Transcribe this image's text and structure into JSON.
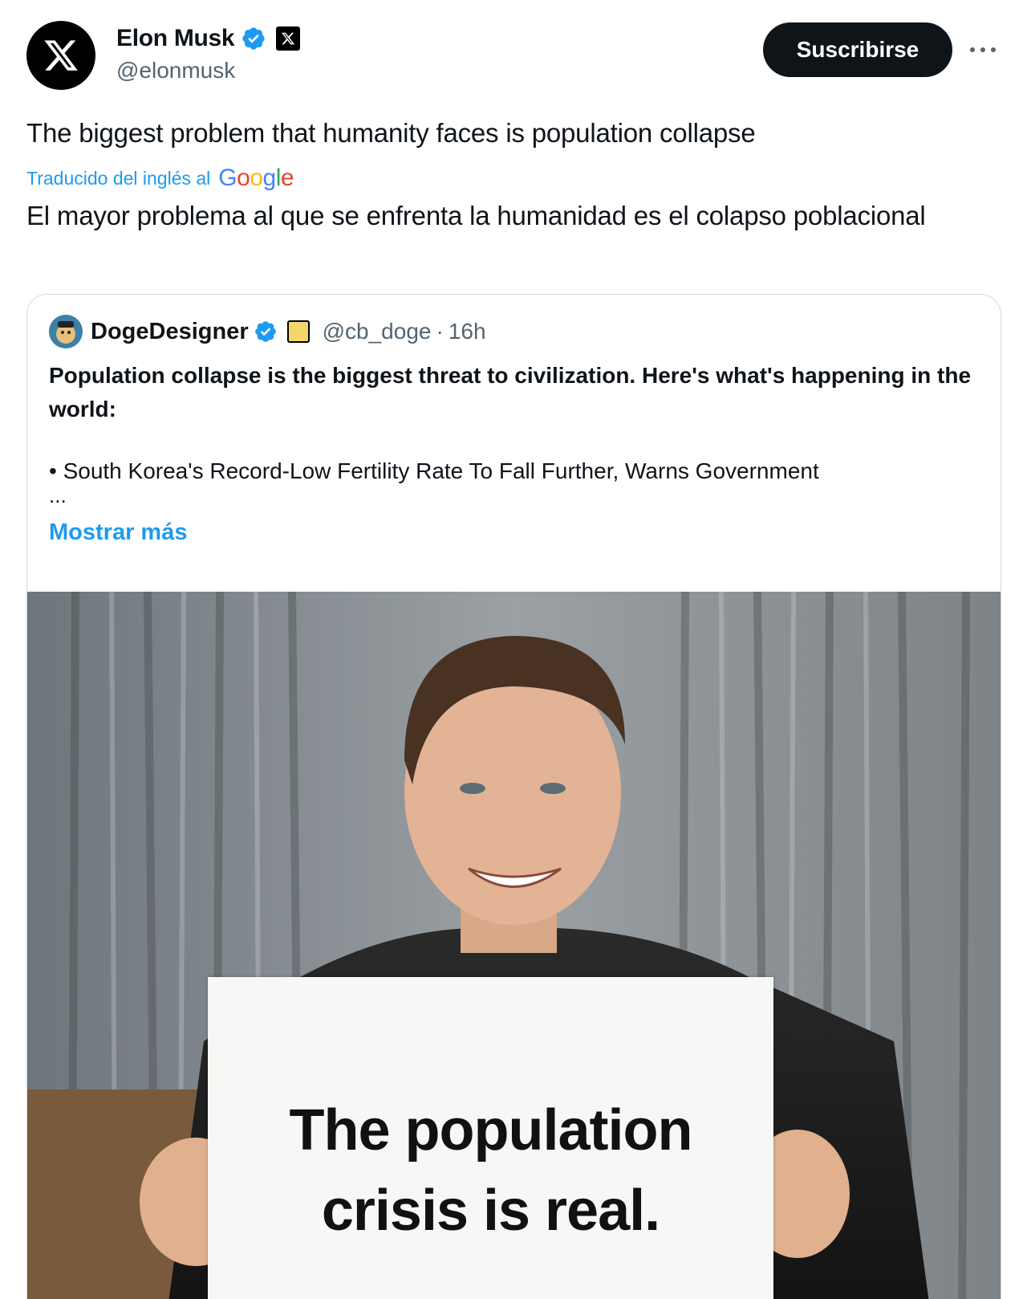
{
  "author": {
    "display_name": "Elon Musk",
    "handle": "@elonmusk",
    "avatar_icon": "x-logo-icon",
    "verified_icon": "verified-badge-icon",
    "affiliate_icon": "x-affiliate-badge-icon"
  },
  "actions": {
    "subscribe_label": "Suscribirse",
    "more_icon": "more-options-icon"
  },
  "tweet": {
    "text": "The biggest problem that humanity faces is population collapse",
    "translation_label": "Traducido del inglés al",
    "translation_provider": "Google",
    "translated_text": "El mayor problema al que se enfrenta la humanidad es el colapso poblacional"
  },
  "quote": {
    "display_name": "DogeDesigner",
    "handle": "@cb_doge",
    "separator": "·",
    "time": "16h",
    "body": "Population collapse is the biggest threat to civilization. Here's what's happening in the world:",
    "bullet": "• South Korea's Record-Low Fertility Rate To Fall Further, Warns Government",
    "ellipsis": "...",
    "show_more_label": "Mostrar más",
    "image": {
      "sign_line_1": "The population",
      "sign_line_2": "crisis is real."
    }
  },
  "colors": {
    "accent_blue": "#1d9bf0",
    "text_primary": "#0f1419",
    "text_secondary": "#536471",
    "border": "#cfd9de",
    "button_bg": "#0f1419"
  }
}
